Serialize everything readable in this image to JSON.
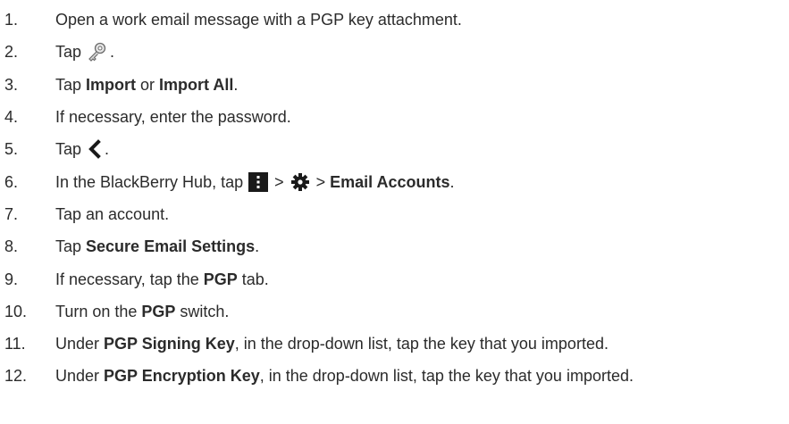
{
  "steps": [
    {
      "num": "1.",
      "parts": [
        "Open a work email message with a PGP key attachment."
      ]
    },
    {
      "num": "2.",
      "parts": [
        "Tap",
        "."
      ]
    },
    {
      "num": "3.",
      "parts": [
        "Tap ",
        "Import",
        " or ",
        "Import All",
        "."
      ]
    },
    {
      "num": "4.",
      "parts": [
        "If necessary, enter the password."
      ]
    },
    {
      "num": "5.",
      "parts": [
        "Tap",
        "."
      ]
    },
    {
      "num": "6.",
      "parts": [
        "In the BlackBerry Hub, tap",
        " > ",
        " > ",
        "Email Accounts",
        "."
      ]
    },
    {
      "num": "7.",
      "parts": [
        "Tap an account."
      ]
    },
    {
      "num": "8.",
      "parts": [
        "Tap ",
        "Secure Email Settings",
        "."
      ]
    },
    {
      "num": "9.",
      "parts": [
        "If necessary, tap the ",
        "PGP",
        " tab."
      ]
    },
    {
      "num": "10.",
      "parts": [
        "Turn on the ",
        "PGP",
        " switch."
      ]
    },
    {
      "num": "11.",
      "parts": [
        "Under ",
        "PGP Signing Key",
        ", in the drop-down list, tap the key that you imported."
      ]
    },
    {
      "num": "12.",
      "parts": [
        "Under ",
        "PGP Encryption Key",
        ", in the drop-down list, tap the key that you imported."
      ]
    }
  ],
  "icons": {
    "step2": "key-icon",
    "step5": "back-icon",
    "step6_a": "menu-icon",
    "step6_b": "gear-icon"
  },
  "colors": {
    "text": "#2b2b2b",
    "icon_dark": "#1a1a1a"
  }
}
